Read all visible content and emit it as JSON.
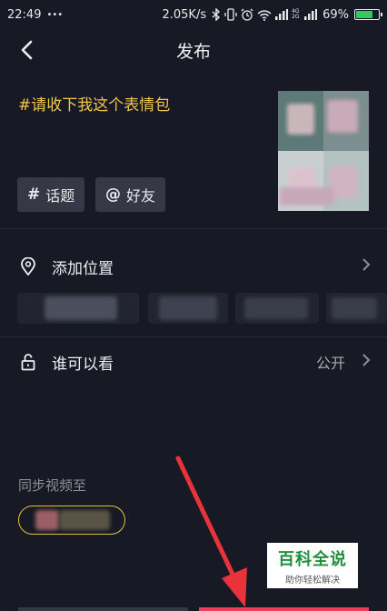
{
  "status_bar": {
    "time": "22:49",
    "dots": "•••",
    "speed": "2.05K/s",
    "network_small": "4G 2G",
    "battery_pct": "69%",
    "battery_level": 0.69,
    "icons": [
      "bluetooth-icon",
      "vibrate-icon",
      "alarm-icon",
      "wifi-icon",
      "signal-icon",
      "battery-icon"
    ]
  },
  "header": {
    "title": "发布"
  },
  "caption": "#请收下我这个表情包",
  "tags": [
    {
      "symbol": "#",
      "label": "话题"
    },
    {
      "symbol": "@",
      "label": "好友"
    }
  ],
  "location": {
    "label": "添加位置"
  },
  "visibility": {
    "label": "谁可以看",
    "value": "公开"
  },
  "sync": {
    "label": "同步视频至"
  },
  "watermark": {
    "title": "百科全说",
    "subtitle": "助你轻松解决"
  },
  "colors": {
    "background": "#171a24",
    "caption": "#f2c64a",
    "accent_red": "#f03c59",
    "sync_border": "#e4c042",
    "tag_bg": "#363945",
    "watermark_green": "#1e8f3c"
  }
}
